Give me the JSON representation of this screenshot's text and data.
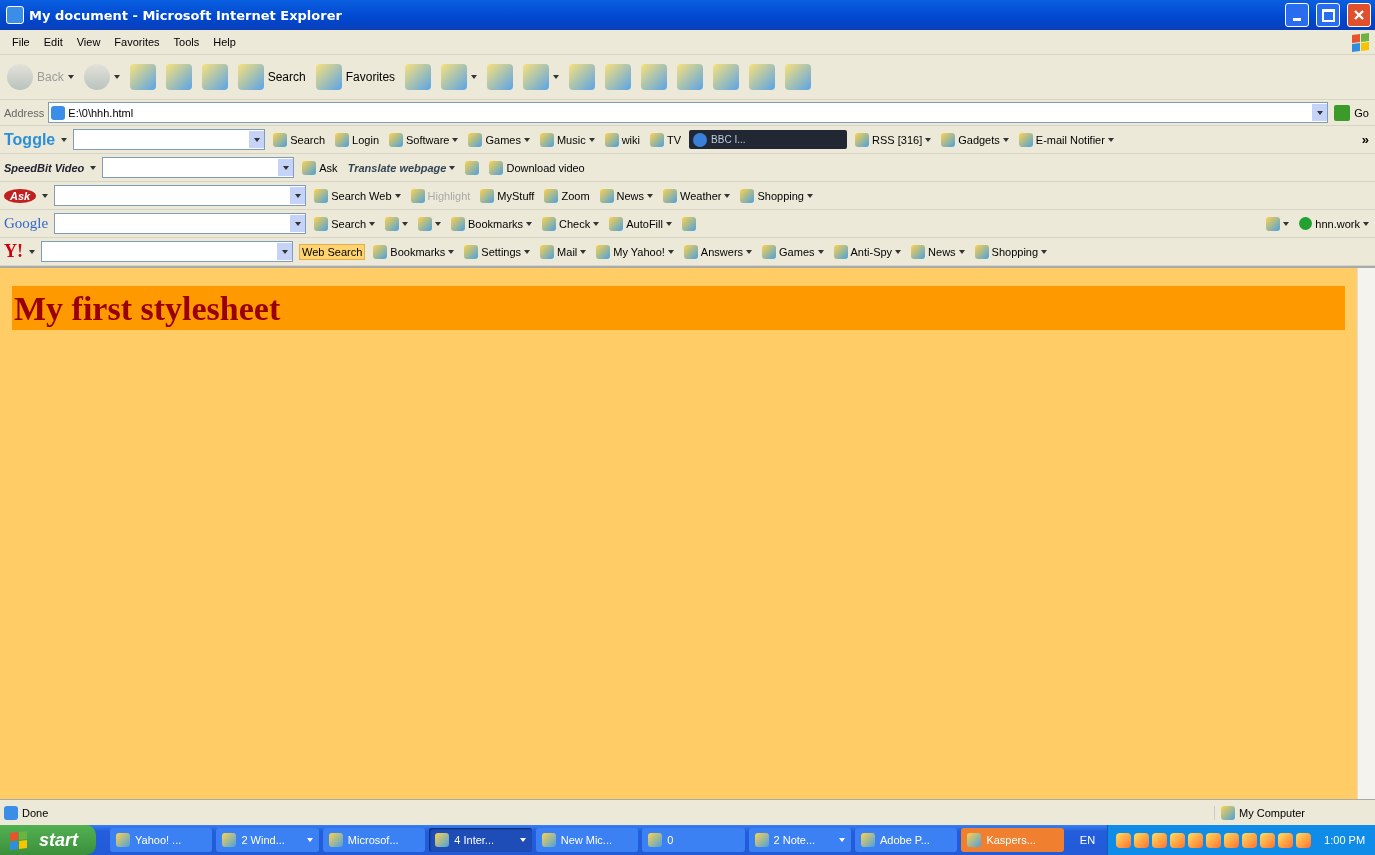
{
  "window": {
    "title": "My document - Microsoft Internet Explorer"
  },
  "menu": [
    "File",
    "Edit",
    "View",
    "Favorites",
    "Tools",
    "Help"
  ],
  "standard_buttons": [
    {
      "kind": "icon-button",
      "label": "Back",
      "dropdown": true,
      "disabled": true
    },
    {
      "kind": "icon-button",
      "dropdown": true,
      "disabled": true
    },
    {
      "kind": "icon-button",
      "dropdown": false,
      "disabled": false
    },
    {
      "kind": "icon-button",
      "dropdown": false,
      "disabled": false
    },
    {
      "kind": "icon-button",
      "dropdown": false,
      "disabled": false
    },
    {
      "kind": "icon-button",
      "label": "Search",
      "dropdown": false,
      "disabled": false
    },
    {
      "kind": "icon-button",
      "label": "Favorites",
      "dropdown": false,
      "disabled": false
    },
    {
      "kind": "icon-button",
      "dropdown": false,
      "disabled": false
    },
    {
      "kind": "icon-button",
      "dropdown": true,
      "disabled": false
    },
    {
      "kind": "icon-button",
      "dropdown": false,
      "disabled": false
    },
    {
      "kind": "icon-button",
      "dropdown": true,
      "disabled": false
    },
    {
      "kind": "icon-button",
      "dropdown": false,
      "disabled": false
    },
    {
      "kind": "icon-button",
      "dropdown": false,
      "disabled": false
    },
    {
      "kind": "icon-button",
      "dropdown": false,
      "disabled": false
    },
    {
      "kind": "icon-button",
      "dropdown": false,
      "disabled": false
    },
    {
      "kind": "icon-button",
      "dropdown": false,
      "disabled": false
    },
    {
      "kind": "icon-button",
      "dropdown": false,
      "disabled": false
    },
    {
      "kind": "icon-button",
      "dropdown": false,
      "disabled": false
    }
  ],
  "address": {
    "label": "Address",
    "value": "E:\\0\\hhh.html",
    "go": "Go"
  },
  "toolbars": [
    {
      "brand": "Toggle",
      "brand_dropdown": true,
      "items": [
        {
          "kind": "field"
        },
        {
          "kind": "icon-button",
          "label": "Search",
          "dropdown": false
        },
        {
          "kind": "icon-button",
          "label": "Login",
          "dropdown": false
        },
        {
          "kind": "icon-button",
          "label": "Software",
          "dropdown": true
        },
        {
          "kind": "icon-button",
          "label": "Games",
          "dropdown": true
        },
        {
          "kind": "icon-button",
          "label": "Music",
          "dropdown": true
        },
        {
          "kind": "icon-button",
          "label": "wiki",
          "dropdown": false
        },
        {
          "kind": "icon-button",
          "label": "TV",
          "dropdown": false
        },
        {
          "kind": "player",
          "label": "BBC I..."
        },
        {
          "kind": "icon-button",
          "label": "RSS [316]",
          "dropdown": true
        },
        {
          "kind": "icon-button",
          "label": "Gadgets",
          "dropdown": true
        },
        {
          "kind": "icon-button",
          "label": "E-mail Notifier",
          "dropdown": true
        },
        {
          "kind": "more",
          "label": "»"
        }
      ]
    },
    {
      "brand": "SpeedBit Video",
      "brand_dropdown": true,
      "items": [
        {
          "kind": "field"
        },
        {
          "kind": "icon-button",
          "label": "Ask",
          "dropdown": false
        },
        {
          "kind": "text-button",
          "label": "Translate webpage",
          "dropdown": true
        },
        {
          "kind": "icon-button",
          "dropdown": false
        },
        {
          "kind": "icon-button",
          "label": "Download video",
          "dropdown": false
        }
      ]
    },
    {
      "brand": "Ask",
      "brand_dropdown": true,
      "items": [
        {
          "kind": "field"
        },
        {
          "kind": "icon-button",
          "label": "Search Web",
          "dropdown": true
        },
        {
          "kind": "icon-button",
          "label": "Highlight",
          "dropdown": false,
          "disabled": true
        },
        {
          "kind": "icon-button",
          "label": "MyStuff",
          "dropdown": false
        },
        {
          "kind": "icon-button",
          "label": "Zoom",
          "dropdown": false
        },
        {
          "kind": "icon-button",
          "label": "News",
          "dropdown": true
        },
        {
          "kind": "icon-button",
          "label": "Weather",
          "dropdown": true
        },
        {
          "kind": "icon-button",
          "label": "Shopping",
          "dropdown": true
        }
      ]
    },
    {
      "brand": "Google",
      "brand_dropdown": false,
      "items": [
        {
          "kind": "field"
        },
        {
          "kind": "icon-button",
          "label": "Search",
          "dropdown": true
        },
        {
          "kind": "icon-button",
          "dropdown": true
        },
        {
          "kind": "icon-button",
          "dropdown": true
        },
        {
          "kind": "icon-button",
          "label": "Bookmarks",
          "dropdown": true
        },
        {
          "kind": "icon-button",
          "label": "Check",
          "dropdown": true
        },
        {
          "kind": "icon-button",
          "label": "AutoFill",
          "dropdown": true
        },
        {
          "kind": "icon-button",
          "dropdown": false
        },
        {
          "kind": "spacer"
        },
        {
          "kind": "icon-button",
          "dropdown": true
        },
        {
          "kind": "account",
          "label": "hnn.work",
          "dropdown": true
        }
      ]
    },
    {
      "brand": "Y!",
      "brand_dropdown": true,
      "items": [
        {
          "kind": "field"
        },
        {
          "kind": "text-button",
          "label": "Web Search",
          "dropdown": false,
          "highlighted": true
        },
        {
          "kind": "icon-button",
          "label": "Bookmarks",
          "dropdown": true
        },
        {
          "kind": "icon-button",
          "label": "Settings",
          "dropdown": true
        },
        {
          "kind": "icon-button",
          "label": "Mail",
          "dropdown": true
        },
        {
          "kind": "icon-button",
          "label": "My Yahoo!",
          "dropdown": true
        },
        {
          "kind": "icon-button",
          "label": "Answers",
          "dropdown": true
        },
        {
          "kind": "icon-button",
          "label": "Games",
          "dropdown": true
        },
        {
          "kind": "icon-button",
          "label": "Anti-Spy",
          "dropdown": true
        },
        {
          "kind": "icon-button",
          "label": "News",
          "dropdown": true
        },
        {
          "kind": "icon-button",
          "label": "Shopping",
          "dropdown": true
        }
      ]
    }
  ],
  "page": {
    "heading": "My first stylesheet"
  },
  "status_bar": {
    "text": "Done",
    "zone": "My Computer"
  },
  "taskbar": {
    "start": "start",
    "tasks": [
      {
        "label": "Yahoo! ...",
        "dropdown": false,
        "selected": false,
        "flashing": false
      },
      {
        "label": "2 Wind...",
        "dropdown": true,
        "selected": false,
        "flashing": false
      },
      {
        "label": "Microsof...",
        "dropdown": false,
        "selected": false,
        "flashing": false
      },
      {
        "label": "4 Inter...",
        "dropdown": true,
        "selected": true,
        "flashing": false
      },
      {
        "label": "New Mic...",
        "dropdown": false,
        "selected": false,
        "flashing": false
      },
      {
        "label": "0",
        "dropdown": false,
        "selected": false,
        "flashing": false
      },
      {
        "label": "2 Note...",
        "dropdown": true,
        "selected": false,
        "flashing": false
      },
      {
        "label": "Adobe P...",
        "dropdown": false,
        "selected": false,
        "flashing": false
      },
      {
        "label": "Kaspers...",
        "dropdown": false,
        "selected": false,
        "flashing": true
      }
    ],
    "language": "EN",
    "clock": "1:00 PM"
  }
}
